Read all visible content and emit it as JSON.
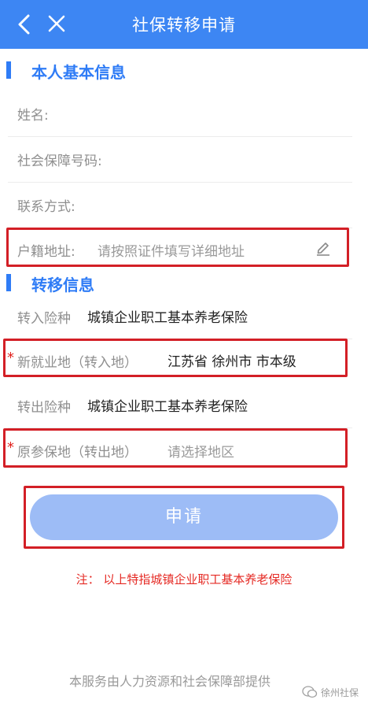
{
  "header": {
    "title": "社保转移申请",
    "back_icon": "chevron-left-icon",
    "close_icon": "close-icon"
  },
  "basic_info": {
    "section_title": "本人基本信息",
    "name_label": "姓名:",
    "ssn_label": "社会保障号码:",
    "contact_label": "联系方式:",
    "address_label": "户籍地址:",
    "address_placeholder": "请按照证件填写详细地址",
    "edit_icon": "pencil-icon"
  },
  "transfer_info": {
    "section_title": "转移信息",
    "in_insurance_label": "转入险种",
    "in_insurance_value": "城镇企业职工基本养老保险",
    "required_mark": "*",
    "new_location_label": "新就业地（转入地）",
    "new_location_value": "江苏省 徐州市 市本级",
    "out_insurance_label": "转出险种",
    "out_insurance_value": "城镇企业职工基本养老保险",
    "original_location_label": "原参保地（转出地）",
    "original_location_placeholder": "请选择地区"
  },
  "apply_button": "申请",
  "note": "注：  以上特指城镇企业职工基本养老保险",
  "footer": "本服务由人力资源和社会保障部提供",
  "watermark": "徐州社保",
  "colors": {
    "header_bg": "#3d86f3",
    "accent": "#2f7cf6",
    "button_bg": "#9dbcf6",
    "highlight_box": "#d31f26",
    "note_text": "#e52a24"
  }
}
